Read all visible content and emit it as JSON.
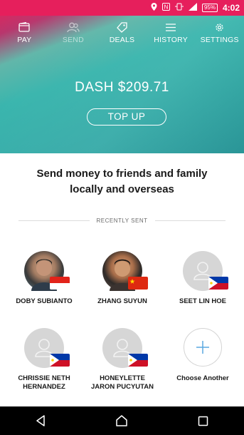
{
  "status_bar": {
    "battery": "95%",
    "time": "4:02",
    "icons": [
      "location-icon",
      "nfc-icon",
      "sync-icon",
      "signal-icon",
      "battery-icon"
    ]
  },
  "tabs": [
    {
      "label": "PAY",
      "icon": "wallet-icon",
      "active": false
    },
    {
      "label": "SEND",
      "icon": "people-icon",
      "active": true
    },
    {
      "label": "DEALS",
      "icon": "tag-icon",
      "active": false
    },
    {
      "label": "HISTORY",
      "icon": "list-icon",
      "active": false
    },
    {
      "label": "SETTINGS",
      "icon": "gear-icon",
      "active": false
    }
  ],
  "balance": "DASH $209.71",
  "top_up_label": "TOP UP",
  "headline_line1": "Send money to friends and family",
  "headline_line2": "locally and overseas",
  "recently_sent_label": "RECENTLY SENT",
  "contacts": [
    {
      "name_line1": "DOBY SUBIANTO",
      "name_line2": "",
      "flag": "indonesia",
      "avatar": "photo"
    },
    {
      "name_line1": "ZHANG SUYUN",
      "name_line2": "",
      "flag": "china",
      "avatar": "photo"
    },
    {
      "name_line1": "SEET LIN HOE",
      "name_line2": "",
      "flag": "philippines",
      "avatar": "placeholder"
    },
    {
      "name_line1": "CHRISSIE NETH",
      "name_line2": "HERNANDEZ",
      "flag": "philippines",
      "avatar": "placeholder"
    },
    {
      "name_line1": "HONEYLETTE",
      "name_line2": "JARON PUCYUTAN",
      "flag": "philippines",
      "avatar": "placeholder"
    }
  ],
  "choose_another_label": "Choose Another",
  "colors": {
    "status_bar": "#e61f5c",
    "hero_teal": "#34b3ab",
    "accent_blue": "#5aa8e0"
  },
  "nav": [
    "back-icon",
    "home-icon",
    "recents-icon"
  ]
}
